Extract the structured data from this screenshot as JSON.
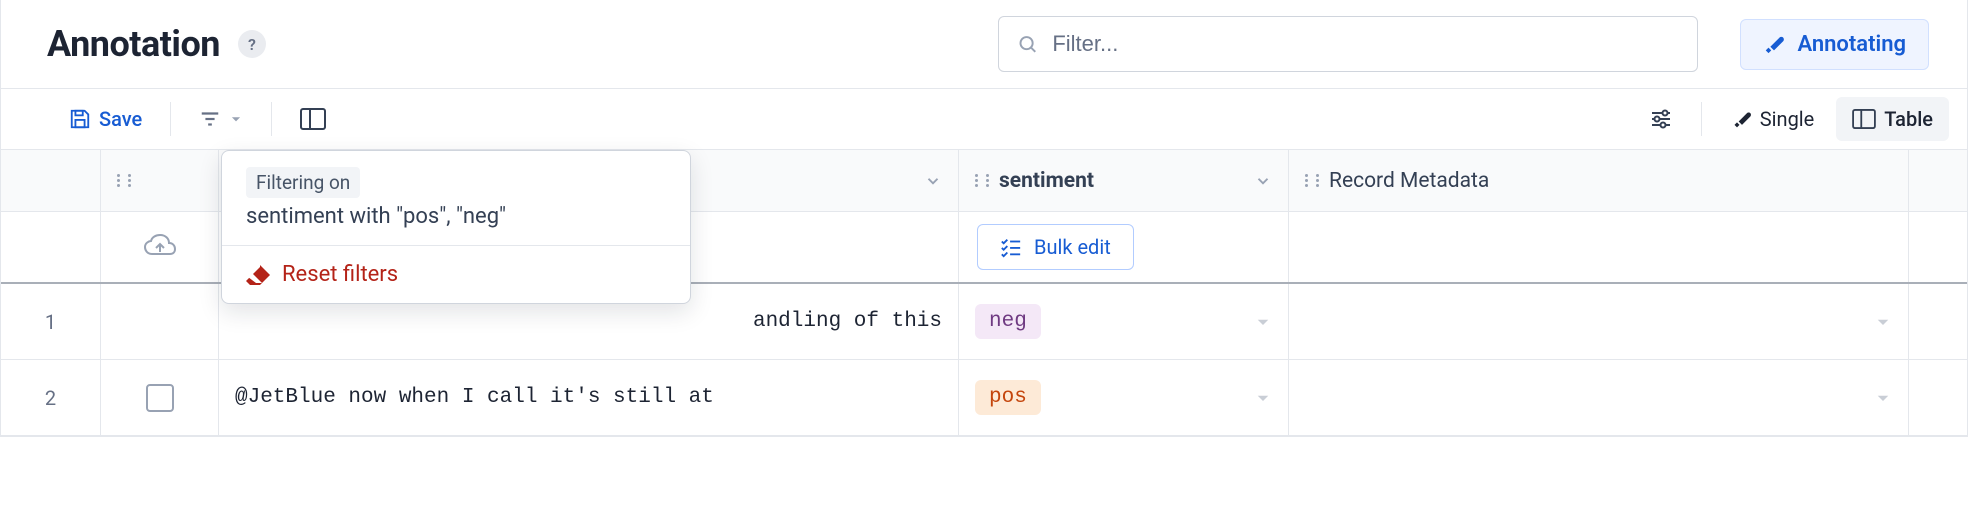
{
  "header": {
    "title": "Annotation",
    "help_glyph": "?",
    "search_placeholder": "Filter...",
    "annotating_label": "Annotating"
  },
  "toolbar": {
    "save_label": "Save",
    "view_single": "Single",
    "view_table": "Table"
  },
  "popover": {
    "filtering_on_label": "Filtering on",
    "filter_desc": "sentiment with \"pos\", \"neg\"",
    "reset_label": "Reset filters"
  },
  "columns": {
    "sentiment": "sentiment",
    "metadata": "Record Metadata",
    "bulk_edit": "Bulk edit"
  },
  "rows": [
    {
      "num": "1",
      "text_tail": "andling of this",
      "sentiment": "neg"
    },
    {
      "num": "2",
      "text": "@JetBlue now when I call it's still at",
      "sentiment": "pos"
    }
  ]
}
